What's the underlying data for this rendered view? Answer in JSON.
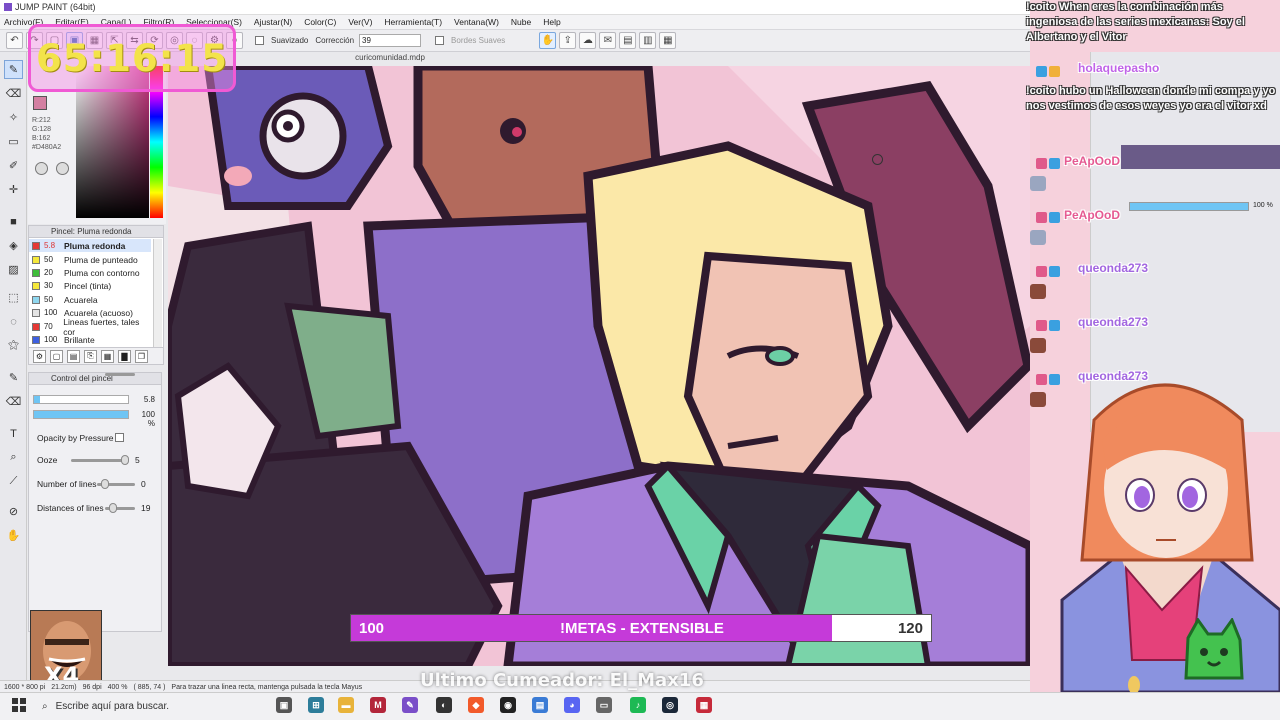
{
  "window": {
    "title": "JUMP PAINT (64bit)"
  },
  "menu": [
    "Archivo(F)",
    "Editar(E)",
    "Capa(L)",
    "Filtro(R)",
    "Seleccionar(S)",
    "Ajustar(N)",
    "Color(C)",
    "Ver(V)",
    "Herramienta(T)",
    "Ventana(W)",
    "Nube",
    "Help"
  ],
  "toolbar": {
    "smoothing_label": "Suavizado",
    "correction_label": "Corrección",
    "correction_value": "39",
    "soft_edges_label": "Bordes Suaves"
  },
  "document": {
    "tab": "curicomunidad.mdp"
  },
  "timer": "65:16:15",
  "color": {
    "r": "R:212",
    "g": "G:128",
    "b": "B:162",
    "hex": "#D480A2",
    "hex_label": "#D480A2"
  },
  "brush_panel": {
    "title": "Pincel: Pluma redonda",
    "items": [
      {
        "size": "5.8",
        "name": "Pluma redonda",
        "color": "#e53935"
      },
      {
        "size": "50",
        "name": "Pluma de punteado",
        "color": "#f5e83b"
      },
      {
        "size": "20",
        "name": "Pluma con contorno",
        "color": "#3fbd3a"
      },
      {
        "size": "30",
        "name": "Pincel (tinta)",
        "color": "#f5e83b"
      },
      {
        "size": "50",
        "name": "Acuarela",
        "color": "#8fd7ef"
      },
      {
        "size": "100",
        "name": "Acuarela (acuoso)",
        "color": "#e3e3e3"
      },
      {
        "size": "70",
        "name": "Lineas fuertes, tales cor",
        "color": "#e53935"
      },
      {
        "size": "100",
        "name": "Brillante",
        "color": "#3d5fe0"
      }
    ]
  },
  "brush_control": {
    "title": "Control del pincel",
    "size_value": "5.8",
    "opacity_value": "100 %",
    "opacity_fraction": 1.0,
    "opacity_pressure_label": "Opacity by Pressure",
    "ooze_label": "Ooze",
    "ooze_value": "5",
    "lines_label": "Number of lines",
    "lines_value": "0",
    "distance_label": "Distances of lines",
    "distance_value": "19"
  },
  "overlay": {
    "webcam_caption": "X4",
    "last_cumeador": "Ultimo Cumeador: El_Max16"
  },
  "meta_bar": {
    "start": "100",
    "title": "!METAS - EXTENSIBLE",
    "end": "120",
    "progress": 0.83
  },
  "statusbar": {
    "size": "1600 * 800 pi",
    "unit": "21.2cm)",
    "dpi": "96 dpi",
    "zoom": "400 %",
    "coords": "( 885, 74 )",
    "hint": "Para trazar una linea recta, mantenga pulsada la tecla Mayus"
  },
  "chat": {
    "messages": [
      {
        "user": "",
        "text": "!coito When eres la combinación más ingeniosa de las series mexicanas: Soy el Albertano y el Vitor"
      },
      {
        "user": "holaquepasho",
        "text": "!coito hubo un Halloween donde mi compa y yo nos vestimos de esos weyes yo era el vitor xd"
      },
      {
        "user": "PeApOoD",
        "text": ""
      },
      {
        "user": "PeApOoD",
        "text": ""
      },
      {
        "user": "queonda273",
        "text": ""
      },
      {
        "user": "queonda273",
        "text": ""
      },
      {
        "user": "queonda273",
        "text": ""
      }
    ],
    "right_panel_percent": "100 %"
  },
  "taskbar": {
    "search_placeholder": "Escribe aquí para buscar."
  }
}
